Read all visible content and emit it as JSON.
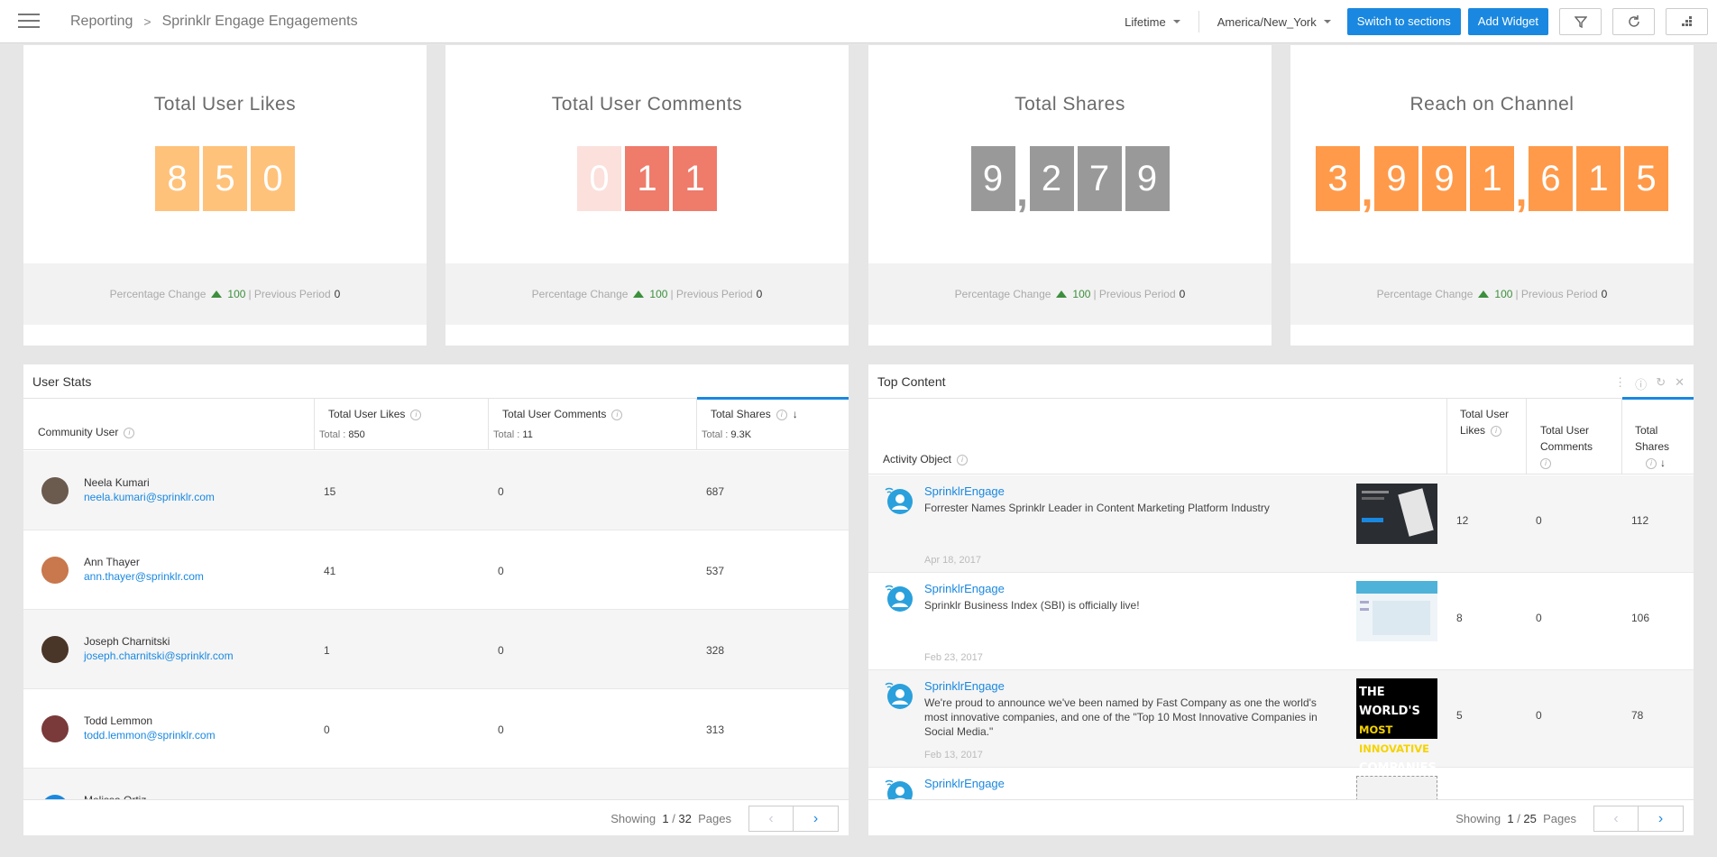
{
  "header": {
    "breadcrumb": [
      "Reporting",
      "Sprinklr Engage Engagements"
    ],
    "time_range": "Lifetime",
    "timezone": "America/New_York",
    "switch_button": "Switch to sections",
    "add_widget_button": "Add Widget",
    "icons": [
      "menu-icon",
      "filter-icon",
      "refresh-icon",
      "layout-icon"
    ]
  },
  "kpis": [
    {
      "title": "Total User Likes",
      "digits": [
        "8",
        "5",
        "0"
      ],
      "color": "#ffc27a",
      "dim_color": "#ffc27a",
      "pct_label": "Percentage Change",
      "pct_value": "100",
      "prev_label": "Previous Period",
      "prev_value": "0"
    },
    {
      "title": "Total User Comments",
      "digits": [
        "0",
        "1",
        "1"
      ],
      "color": "#ef7b6b",
      "dim_color": "#fbe0dc",
      "pct_label": "Percentage Change",
      "pct_value": "100",
      "prev_label": "Previous Period",
      "prev_value": "0"
    },
    {
      "title": "Total Shares",
      "digits": [
        "9",
        ",",
        "2",
        "7",
        "9"
      ],
      "color": "#999999",
      "dim_color": "#999999",
      "pct_label": "Percentage Change",
      "pct_value": "100",
      "prev_label": "Previous Period",
      "prev_value": "0"
    },
    {
      "title": "Reach on Channel",
      "digits": [
        "3",
        ",",
        "9",
        "9",
        "1",
        ",",
        "6",
        "1",
        "5"
      ],
      "color": "#ff9a4a",
      "dim_color": "#ff9a4a",
      "pct_label": "Percentage Change",
      "pct_value": "100",
      "prev_label": "Previous Period",
      "prev_value": "0"
    }
  ],
  "user_stats": {
    "title": "User Stats",
    "columns": {
      "user": "Community User",
      "likes": "Total User Likes",
      "comments": "Total User Comments",
      "shares": "Total Shares"
    },
    "totals": {
      "likes_label": "Total :",
      "likes": "850",
      "comments_label": "Total :",
      "comments": "11",
      "shares_label": "Total :",
      "shares": "9.3K"
    },
    "rows": [
      {
        "name": "Neela Kumari",
        "email": "neela.kumari@sprinklr.com",
        "likes": "15",
        "comments": "0",
        "shares": "687",
        "avatar_color": "#6b5a4e"
      },
      {
        "name": "Ann Thayer",
        "email": "ann.thayer@sprinklr.com",
        "likes": "41",
        "comments": "0",
        "shares": "537",
        "avatar_color": "#c9774d"
      },
      {
        "name": "Joseph Charnitski",
        "email": "joseph.charnitski@sprinklr.com",
        "likes": "1",
        "comments": "0",
        "shares": "328",
        "avatar_color": "#4a3628"
      },
      {
        "name": "Todd Lemmon",
        "email": "todd.lemmon@sprinklr.com",
        "likes": "0",
        "comments": "0",
        "shares": "313",
        "avatar_color": "#7a3a3a"
      },
      {
        "name": "Melissa Ortiz",
        "email": "",
        "likes": "",
        "comments": "",
        "shares": "",
        "avatar_color": "#1a88e0"
      }
    ],
    "footer": {
      "showing": "Showing",
      "page": "1",
      "total": "32",
      "pages_label": "Pages"
    }
  },
  "top_content": {
    "title": "Top Content",
    "columns": {
      "object": "Activity Object",
      "likes": "Total User Likes",
      "comments": "Total User Comments",
      "shares": "Total Shares"
    },
    "rows": [
      {
        "source": "SprinklrEngage",
        "text": "Forrester Names Sprinklr Leader in Content Marketing Platform Industry",
        "date": "Apr 18, 2017",
        "likes": "12",
        "comments": "0",
        "shares": "112"
      },
      {
        "source": "SprinklrEngage",
        "text": "Sprinklr Business Index (SBI) is officially live!",
        "date": "Feb 23, 2017",
        "likes": "8",
        "comments": "0",
        "shares": "106"
      },
      {
        "source": "SprinklrEngage",
        "text": "We're proud to announce we've been named by Fast Company as one the world's most innovative companies, and one of the \"Top 10 Most Innovative Companies in Social Media.\"",
        "date": "Feb 13, 2017",
        "likes": "5",
        "comments": "0",
        "shares": "78"
      },
      {
        "source": "SprinklrEngage",
        "text": "",
        "date": "",
        "likes": "",
        "comments": "",
        "shares": ""
      }
    ],
    "thumb3_text": [
      "THE WORLD'S",
      "MOST INNOVATIVE",
      "COMPANIES"
    ],
    "footer": {
      "showing": "Showing",
      "page": "1",
      "total": "25",
      "pages_label": "Pages"
    }
  }
}
